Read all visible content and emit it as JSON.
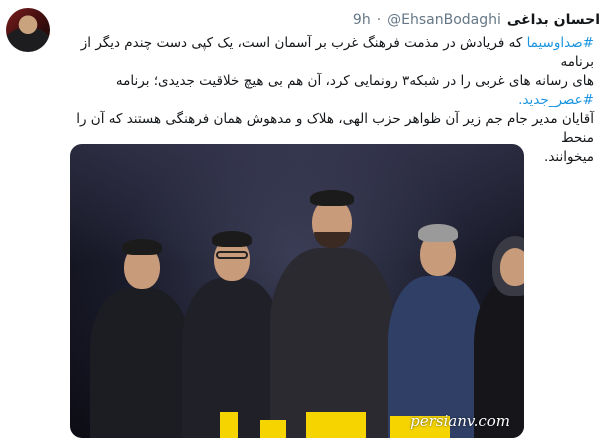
{
  "tweet": {
    "display_name": "احسان بداغی",
    "handle": "@EhsanBodaghi",
    "separator": "·",
    "time": "9h",
    "line1_hashtag": "#صداوسیما",
    "line1_rest": " که فریادش در مذمت فرهنگ غرب بر آسمان است، یک کپی دست چندم دیگر از برنامه",
    "line2": "های رسانه های غربی را در شبکه۳ رونمایی کرد، آن هم بی هیچ خلاقیت جدیدی؛ برنامه",
    "line3_hashtag": "#عصر_جدید.",
    "line4": "آقایان مدیر جام جم زیر آن ظواهر حزب الهی، هلاک و مدهوش همان فرهنگی هستند که آن را منحط",
    "line5": "میخوانند."
  },
  "media": {
    "watermark": "persianv.com"
  },
  "colors": {
    "link": "#1b95e0",
    "text": "#14171a",
    "muted": "#657786"
  }
}
